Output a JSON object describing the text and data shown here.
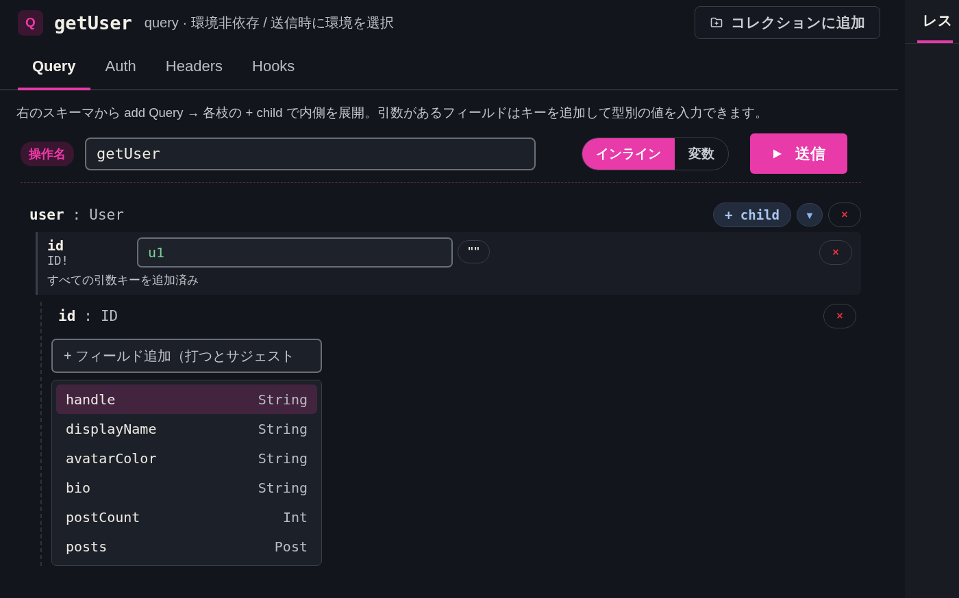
{
  "header": {
    "badge": "Q",
    "title": "getUser",
    "subtitle": "query · 環境非依存 / 送信時に環境を選択",
    "collection_button": "コレクションに追加"
  },
  "tabs": [
    {
      "label": "Query",
      "selected": true
    },
    {
      "label": "Auth",
      "selected": false
    },
    {
      "label": "Headers",
      "selected": false
    },
    {
      "label": "Hooks",
      "selected": false
    }
  ],
  "hint": "右のスキーマから add Query → 各枝の + child で内側を展開。引数があるフィールドはキーを追加して型別の値を入力できます。",
  "operation": {
    "label": "操作名",
    "value": "getUser",
    "modes": [
      {
        "label": "インライン",
        "selected": true
      },
      {
        "label": "変数",
        "selected": false
      }
    ],
    "send_button": "送信"
  },
  "field": {
    "name": "user",
    "separator": ":",
    "type": "User",
    "child_button": "+ child",
    "collapse_button": "▼",
    "remove_button": "×",
    "argument": {
      "name": "id",
      "type": "ID!",
      "value": "u1",
      "quote_button": "\"\"",
      "remove_button": "×",
      "note": "すべての引数キーを追加済み"
    },
    "children": [
      {
        "name": "id",
        "separator": ":",
        "type": "ID",
        "remove_button": "×"
      }
    ],
    "add_field": {
      "placeholder": "+ フィールド追加（打つとサジェスト"
    },
    "suggestions": [
      {
        "name": "handle",
        "type": "String",
        "selected": true
      },
      {
        "name": "displayName",
        "type": "String",
        "selected": false
      },
      {
        "name": "avatarColor",
        "type": "String",
        "selected": false
      },
      {
        "name": "bio",
        "type": "String",
        "selected": false
      },
      {
        "name": "postCount",
        "type": "Int",
        "selected": false
      },
      {
        "name": "posts",
        "type": "Post",
        "selected": false
      }
    ]
  },
  "right_panel": {
    "tabs": [
      {
        "label": "レス",
        "selected": true
      }
    ]
  }
}
